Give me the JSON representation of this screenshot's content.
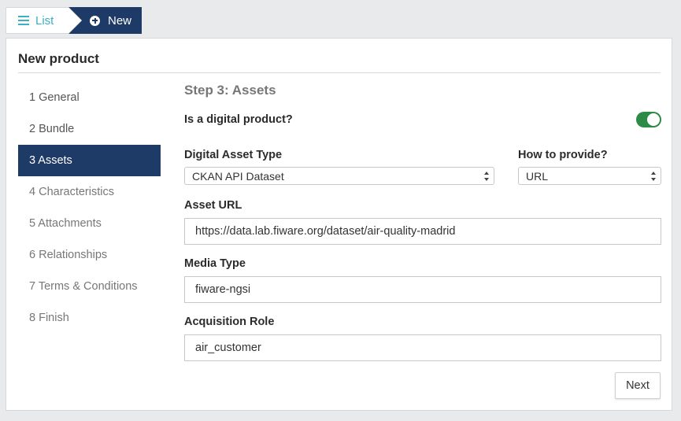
{
  "breadcrumb": {
    "list_label": "List",
    "list_icon": "list-icon",
    "new_label": "New",
    "new_icon": "plus-circle-icon"
  },
  "card": {
    "title": "New product"
  },
  "steps": [
    {
      "label": "1 General"
    },
    {
      "label": "2 Bundle"
    },
    {
      "label": "3 Assets"
    },
    {
      "label": "4 Characteristics"
    },
    {
      "label": "5 Attachments"
    },
    {
      "label": "6 Relationships"
    },
    {
      "label": "7 Terms & Conditions"
    },
    {
      "label": "8 Finish"
    }
  ],
  "active_step": 3,
  "form": {
    "heading": "Step 3: Assets",
    "digital_label": "Is a digital product?",
    "digital_enabled": true,
    "asset_type_label": "Digital Asset Type",
    "asset_type_value": "CKAN API Dataset",
    "provide_label": "How to provide?",
    "provide_value": "URL",
    "asset_url_label": "Asset URL",
    "asset_url_value": "https://data.lab.fiware.org/dataset/air-quality-madrid",
    "media_type_label": "Media Type",
    "media_type_value": "fiware-ngsi",
    "role_label": "Acquisition Role",
    "role_value": "air_customer",
    "next_label": "Next"
  },
  "colors": {
    "primary": "#1e3a66",
    "accent": "#3ab0c4",
    "toggle_on": "#2e8b47"
  }
}
